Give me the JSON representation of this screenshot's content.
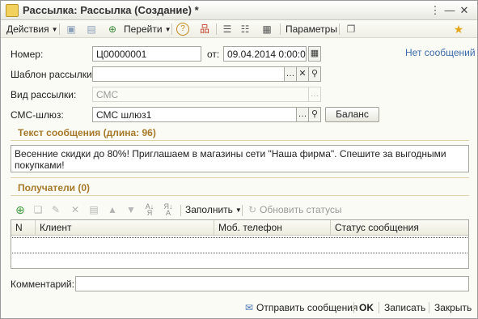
{
  "window": {
    "title": "Рассылка: Рассылка (Создание) *"
  },
  "toolbar": {
    "actions_label": "Действия",
    "goto_label": "Перейти",
    "params_label": "Параметры"
  },
  "form": {
    "number_label": "Номер:",
    "number_value": "Ц00000001",
    "date_label": "от:",
    "date_value": "09.04.2014  0:00:00",
    "no_messages_link": "Нет сообщений",
    "template_label": "Шаблон рассылки:",
    "template_value": "",
    "type_label": "Вид рассылки:",
    "type_value": "СМС",
    "gateway_label": "СМС-шлюз:",
    "gateway_value": "СМС шлюз1",
    "balance_button": "Баланс",
    "message_title": "Текст сообщения (длина: 96)",
    "message_text": "Весенние скидки до 80%! Приглашаем в магазины сети \"Наша фирма\". Спешите за выгодными покупками!",
    "recipients_title": "Получатели (0)",
    "fill_label": "Заполнить",
    "refresh_status_label": "Обновить статусы",
    "table_columns": [
      "N",
      "Клиент",
      "Моб. телефон",
      "Статус сообщения"
    ],
    "comment_label": "Комментарий:",
    "comment_value": ""
  },
  "footer": {
    "send_label": "Отправить сообщения",
    "ok_label": "OK",
    "save_label": "Записать",
    "close_label": "Закрыть"
  },
  "colors": {
    "group_title": "#a6792a",
    "link": "#3b6aa8",
    "background": "#fbfbf5"
  }
}
